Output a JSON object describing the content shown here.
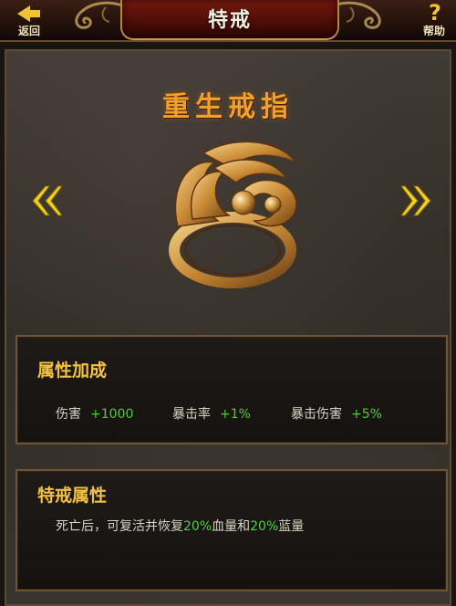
{
  "header": {
    "back_label": "返回",
    "title": "特戒",
    "help_label": "帮助"
  },
  "item": {
    "name": "重生戒指"
  },
  "attributes": {
    "title": "属性加成",
    "stats": [
      {
        "name": "伤害",
        "value": "+1000"
      },
      {
        "name": "暴击率",
        "value": "+1%"
      },
      {
        "name": "暴击伤害",
        "value": "+5%"
      }
    ]
  },
  "special": {
    "title": "特戒属性",
    "desc_part1": "死亡后，可复活并恢复",
    "hp_percent": "20%",
    "desc_part2": "血量和",
    "mp_percent": "20%",
    "desc_part3": "蓝量"
  },
  "colors": {
    "accent_gold": "#f4c242",
    "value_green": "#4ccf37",
    "title_orange": "#f0a12a"
  }
}
